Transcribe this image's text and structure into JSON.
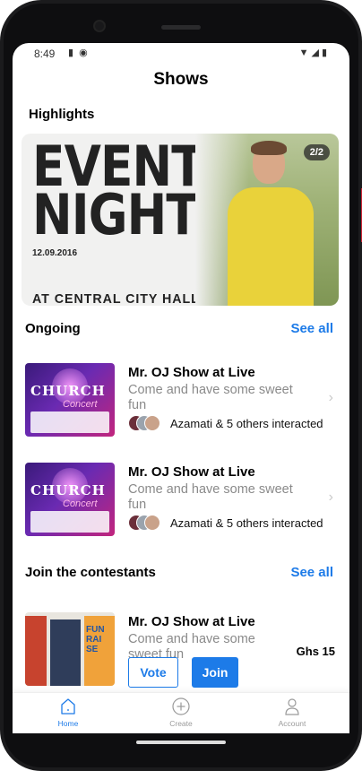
{
  "status_bar": {
    "time": "8:49"
  },
  "page": {
    "title": "Shows"
  },
  "highlights": {
    "label": "Highlights",
    "banner": {
      "headline_line1": "EVENT",
      "headline_line2": "NIGHT",
      "date": "12.09.2016",
      "venue": "AT CENTRAL CITY HALL",
      "counter": "2/2"
    }
  },
  "ongoing": {
    "label": "Ongoing",
    "see_all": "See all",
    "items": [
      {
        "title": "Mr. OJ Show at Live",
        "description": "Come and have some sweet fun",
        "interactions": "Azamati & 5 others interacted",
        "thumb_title": "CHURCH",
        "thumb_subtitle": "Concert"
      },
      {
        "title": "Mr. OJ Show at Live",
        "description": "Come and have some sweet fun",
        "interactions": "Azamati & 5 others interacted",
        "thumb_title": "CHURCH",
        "thumb_subtitle": "Concert"
      }
    ]
  },
  "contestants": {
    "label": "Join the contestants",
    "see_all": "See all",
    "items": [
      {
        "title": "Mr. OJ Show at Live",
        "description": "Come and have some sweet fun",
        "price": "Ghs 15",
        "vote_label": "Vote",
        "join_label": "Join",
        "thumb_text": "FUN RAI SE"
      }
    ]
  },
  "tab_bar": {
    "tabs": [
      {
        "label": "Home",
        "icon": "home-icon",
        "active": true
      },
      {
        "label": "Create",
        "icon": "plus-circle-icon",
        "active": false
      },
      {
        "label": "Account",
        "icon": "user-icon",
        "active": false
      }
    ]
  },
  "colors": {
    "accent": "#1d7be8",
    "muted_text": "#8a8a8a"
  }
}
